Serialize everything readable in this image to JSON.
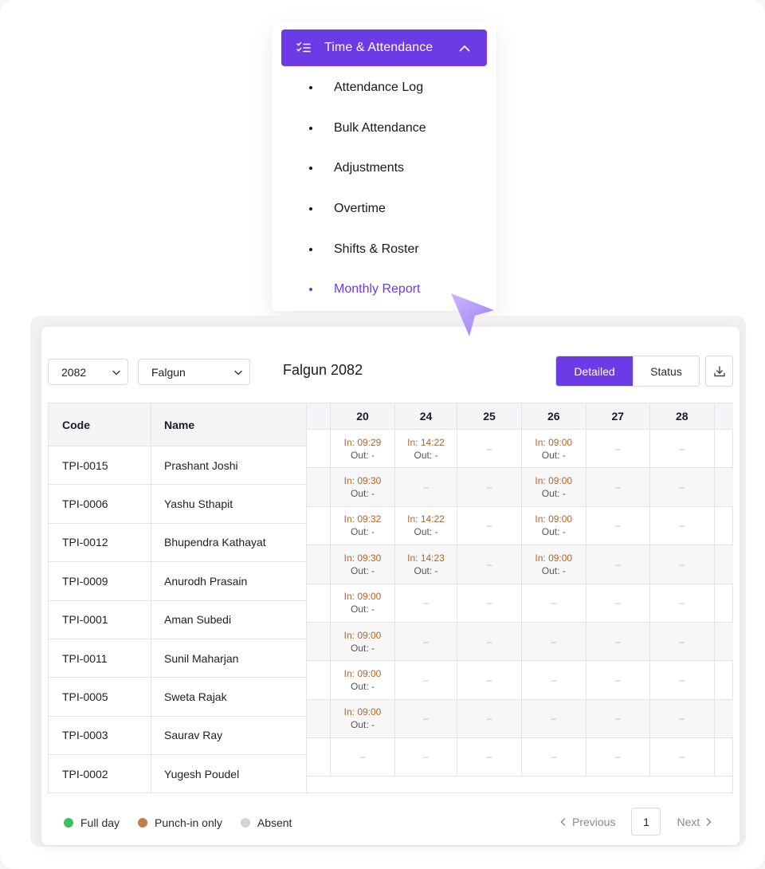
{
  "menu": {
    "title": "Time & Attendance",
    "items": [
      {
        "label": "Attendance Log",
        "active": false
      },
      {
        "label": "Bulk Attendance",
        "active": false
      },
      {
        "label": "Adjustments",
        "active": false
      },
      {
        "label": "Overtime",
        "active": false
      },
      {
        "label": "Shifts & Roster",
        "active": false
      },
      {
        "label": "Monthly Report",
        "active": true
      }
    ]
  },
  "report": {
    "year_select": "2082",
    "month_select": "Falgun",
    "period_title": "Falgun 2082",
    "view_toggle": {
      "detailed": "Detailed",
      "status": "Status",
      "selected": "Detailed"
    },
    "table": {
      "code_header": "Code",
      "name_header": "Name",
      "days": [
        "20",
        "24",
        "25",
        "26",
        "27",
        "28"
      ],
      "rows": [
        {
          "code": "TPI-0015",
          "name": "Prashant Joshi",
          "cells": [
            [
              "In: 09:29",
              "Out: -"
            ],
            [
              "In: 14:22",
              "Out: -"
            ],
            "–",
            [
              "In: 09:00",
              "Out: -"
            ],
            "–",
            "–"
          ]
        },
        {
          "code": "TPI-0006",
          "name": "Yashu Sthapit",
          "cells": [
            [
              "In: 09:30",
              "Out: -"
            ],
            "–",
            "–",
            [
              "In: 09:00",
              "Out: -"
            ],
            "–",
            "–"
          ]
        },
        {
          "code": "TPI-0012",
          "name": "Bhupendra Kathayat",
          "cells": [
            [
              "In: 09:32",
              "Out: -"
            ],
            [
              "In: 14:22",
              "Out: -"
            ],
            "–",
            [
              "In: 09:00",
              "Out: -"
            ],
            "–",
            "–"
          ]
        },
        {
          "code": "TPI-0009",
          "name": "Anurodh Prasain",
          "cells": [
            [
              "In: 09:30",
              "Out: -"
            ],
            [
              "In: 14:23",
              "Out: -"
            ],
            "–",
            [
              "In: 09:00",
              "Out: -"
            ],
            "–",
            "–"
          ]
        },
        {
          "code": "TPI-0001",
          "name": "Aman Subedi",
          "cells": [
            [
              "In: 09:00",
              "Out: -"
            ],
            "–",
            "–",
            "–",
            "–",
            "–"
          ]
        },
        {
          "code": "TPI-0011",
          "name": "Sunil Maharjan",
          "cells": [
            [
              "In: 09:00",
              "Out: -"
            ],
            "–",
            "–",
            "–",
            "–",
            "–"
          ]
        },
        {
          "code": "TPI-0005",
          "name": "Sweta Rajak",
          "cells": [
            [
              "In: 09:00",
              "Out: -"
            ],
            "–",
            "–",
            "–",
            "–",
            "–"
          ]
        },
        {
          "code": "TPI-0003",
          "name": "Saurav Ray",
          "cells": [
            [
              "In: 09:00",
              "Out: -"
            ],
            "–",
            "–",
            "–",
            "–",
            "–"
          ]
        },
        {
          "code": "TPI-0002",
          "name": "Yugesh Poudel",
          "cells": [
            "–",
            "–",
            "–",
            "–",
            "–",
            "–"
          ]
        }
      ]
    },
    "legend": [
      {
        "label": "Full day",
        "color": "#3fbf62"
      },
      {
        "label": "Punch-in only",
        "color": "#c27d4e"
      },
      {
        "label": "Absent",
        "color": "#d4d4d8"
      }
    ],
    "pagination": {
      "previous": "Previous",
      "page": "1",
      "next": "Next"
    }
  },
  "colors": {
    "accent": "#6d3be6",
    "punch_in_text": "#b0652c"
  },
  "icons": {
    "menu": "checklist-icon",
    "collapse": "chevron-up-icon",
    "download": "download-icon",
    "cursor": "pointer-cursor-icon"
  }
}
